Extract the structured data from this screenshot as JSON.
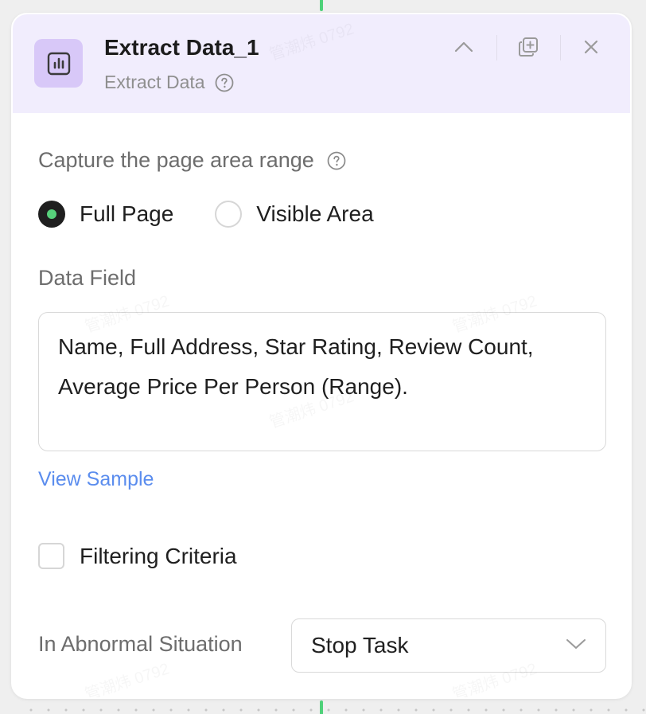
{
  "node": {
    "title": "Extract Data_1",
    "subtitle": "Extract Data",
    "icon": "bar-chart-icon",
    "accent_color": "#d8c8f8",
    "header_background": "#f1edfd"
  },
  "header_actions": {
    "collapse_icon": "chevron-up-icon",
    "duplicate_icon": "duplicate-icon",
    "close_icon": "close-icon"
  },
  "capture": {
    "label": "Capture the page area range",
    "options": [
      {
        "label": "Full Page",
        "selected": true
      },
      {
        "label": "Visible Area",
        "selected": false
      }
    ],
    "selected_color": "#57d17b"
  },
  "data_field": {
    "label": "Data Field",
    "value": "Name, Full Address, Star Rating, Review Count, Average Price Per Person (Range)."
  },
  "view_sample": {
    "label": "View Sample",
    "color": "#5b8dee"
  },
  "filtering": {
    "label": "Filtering Criteria",
    "checked": false
  },
  "abnormal": {
    "label": "In Abnormal Situation",
    "selected_value": "Stop Task"
  },
  "watermark": {
    "text": "管潮炜 0792"
  }
}
